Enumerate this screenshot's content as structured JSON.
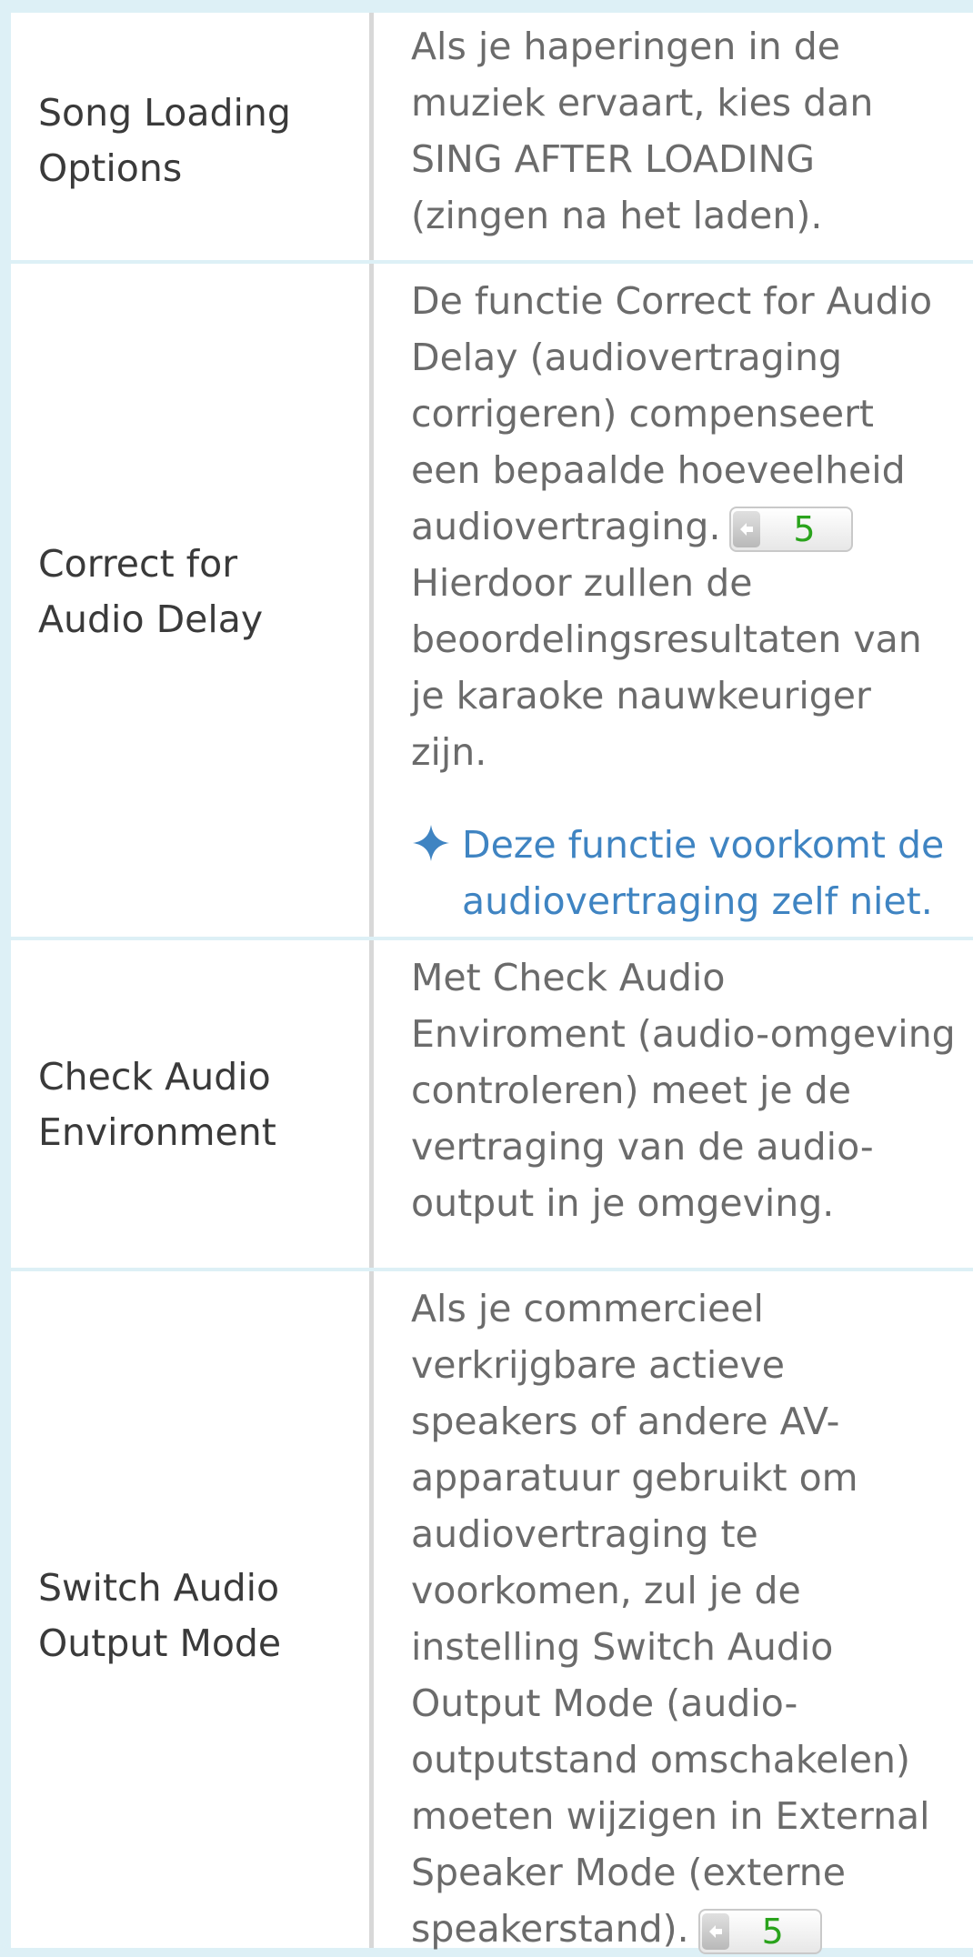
{
  "rows": [
    {
      "label": "Song Loading\nOptions",
      "desc": "Als je haperingen in de\nmuziek ervaart, kies dan\nSING AFTER LOADING\n(zingen na het laden)."
    },
    {
      "label": "Correct for\nAudio Delay",
      "desc_before": "De functie Correct for Audio\nDelay (audiovertraging\ncorrigeren) compenseert\neen bepaalde hoeveelheid\naudiovertraging.",
      "ref": "5",
      "desc_after": "Hierdoor zullen de\nbeoordelingsresultaten van\nje karaoke nauwkeuriger\nzijn.",
      "note": "Deze functie voorkomt de\naudiovertraging zelf niet."
    },
    {
      "label": "Check Audio\nEnvironment",
      "desc": "Met Check Audio\nEnviroment (audio-omgeving\ncontroleren) meet je de\nvertraging van de audio-\noutput in je omgeving."
    },
    {
      "label": "Switch Audio\nOutput Mode",
      "desc_before": "Als je commercieel\nverkrijgbare actieve\nspeakers of andere AV-\napparatuur gebruikt om\naudiovertraging te\nvoorkomen, zul je de\ninstelling Switch Audio\nOutput Mode (audio-\noutputstand omschakelen)\nmoeten wijzigen in External\nSpeaker Mode (externe\nspeakerstand).",
      "ref": "5"
    }
  ],
  "icons": {
    "note": "diamond-bullet-icon",
    "ref": "page-reference-arrow-icon"
  },
  "colors": {
    "background": "#ddf0f6",
    "note": "#3f84c2",
    "ref_number": "#2aa31c"
  }
}
